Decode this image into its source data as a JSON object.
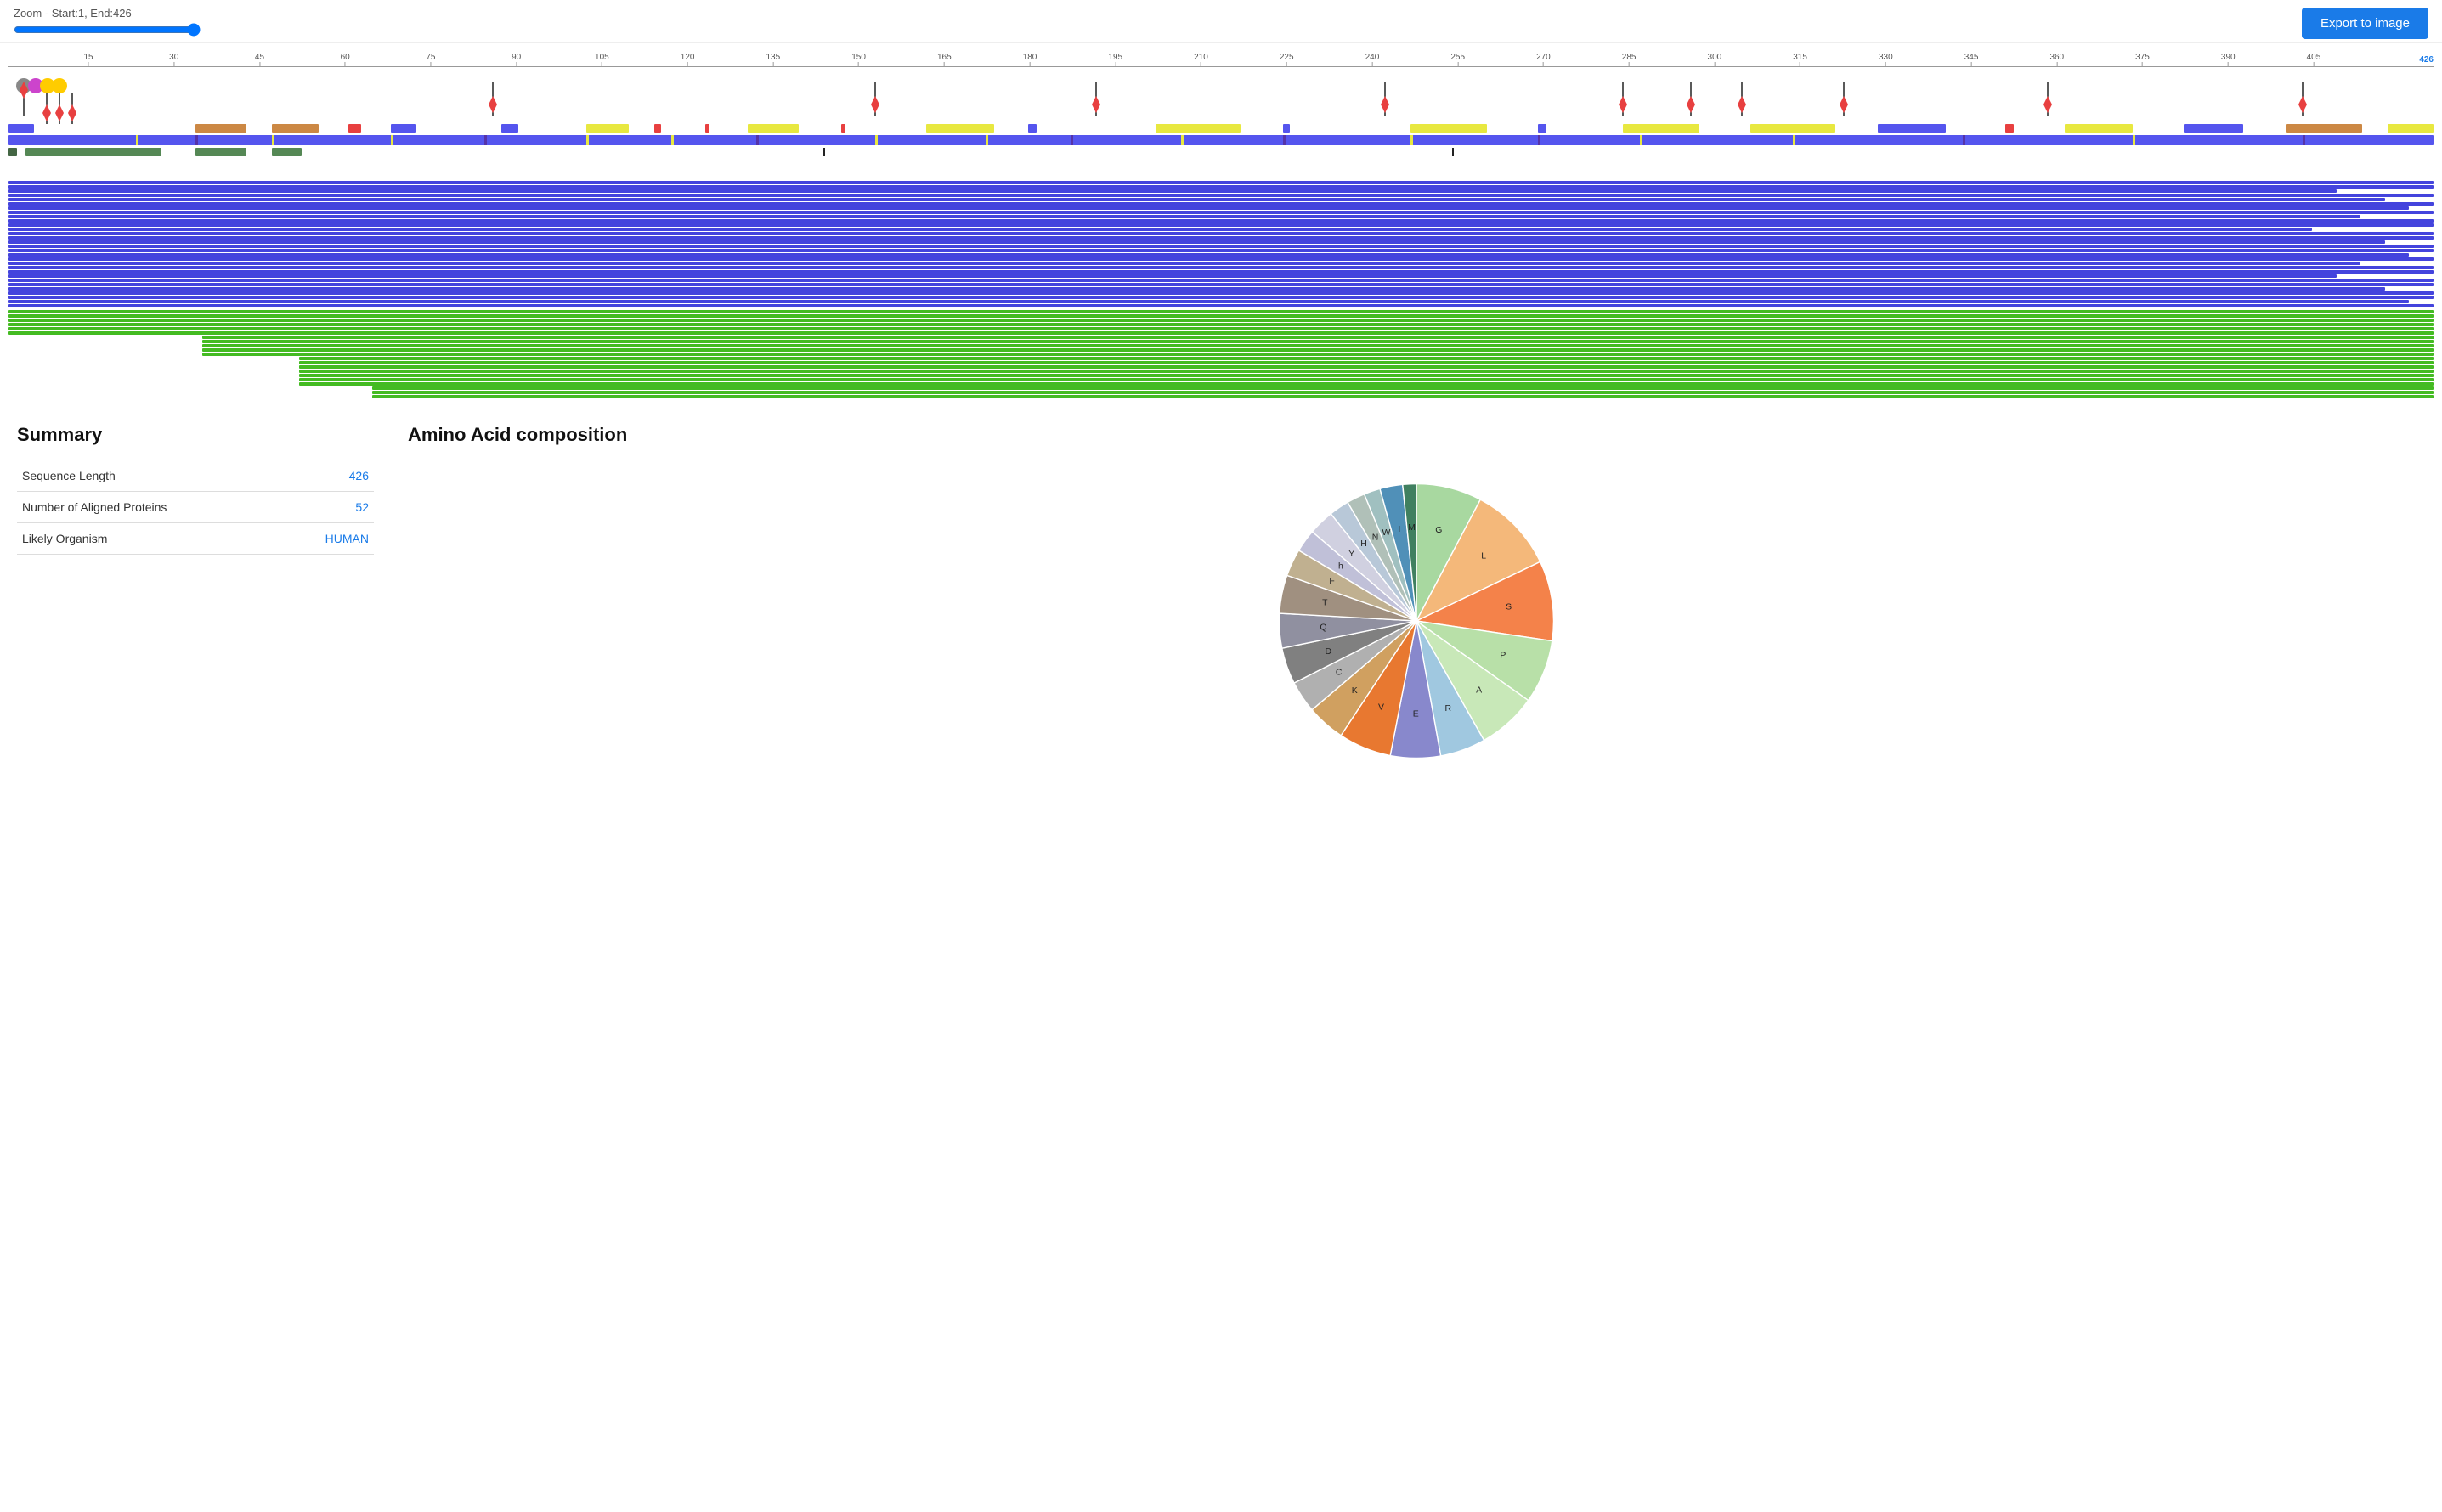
{
  "topbar": {
    "zoom_label": "Zoom - Start:1, End:426",
    "export_button": "Export to image"
  },
  "ruler": {
    "start": 1,
    "end": 426,
    "ticks": [
      15,
      30,
      45,
      60,
      75,
      90,
      105,
      120,
      135,
      150,
      165,
      180,
      195,
      210,
      225,
      240,
      255,
      270,
      285,
      300,
      315,
      330,
      345,
      360,
      375,
      390,
      405
    ]
  },
  "summary": {
    "title": "Summary",
    "rows": [
      {
        "label": "Sequence Length",
        "value": "426"
      },
      {
        "label": "Number of Aligned Proteins",
        "value": "52"
      },
      {
        "label": "Likely Organism",
        "value": "HUMAN"
      }
    ]
  },
  "amino_acid": {
    "title": "Amino Acid composition",
    "segments": [
      {
        "label": "G",
        "value": 7.2,
        "color": "#a8d8a0"
      },
      {
        "label": "L",
        "value": 9.5,
        "color": "#f4b87a"
      },
      {
        "label": "S",
        "value": 8.8,
        "color": "#f4824a"
      },
      {
        "label": "P",
        "value": 7.0,
        "color": "#b8e0a8"
      },
      {
        "label": "A",
        "value": 6.5,
        "color": "#c8e8b8"
      },
      {
        "label": "R",
        "value": 5.0,
        "color": "#a0c8e0"
      },
      {
        "label": "E",
        "value": 5.5,
        "color": "#8888cc"
      },
      {
        "label": "V",
        "value": 5.8,
        "color": "#e87830"
      },
      {
        "label": "K",
        "value": 4.2,
        "color": "#d0a060"
      },
      {
        "label": "C",
        "value": 3.5,
        "color": "#b0b0b0"
      },
      {
        "label": "D",
        "value": 4.0,
        "color": "#808080"
      },
      {
        "label": "Q",
        "value": 3.8,
        "color": "#9090a0"
      },
      {
        "label": "T",
        "value": 4.2,
        "color": "#a09080"
      },
      {
        "label": "F",
        "value": 3.0,
        "color": "#c0b090"
      },
      {
        "label": "h",
        "value": 2.5,
        "color": "#c0c0d8"
      },
      {
        "label": "Y",
        "value": 2.8,
        "color": "#d0d0e0"
      },
      {
        "label": "H",
        "value": 2.2,
        "color": "#b8c8d8"
      },
      {
        "label": "N",
        "value": 2.0,
        "color": "#b0c0b8"
      },
      {
        "label": "W",
        "value": 1.8,
        "color": "#a0c0c0"
      },
      {
        "label": "I",
        "value": 2.5,
        "color": "#5090b8"
      },
      {
        "label": "M",
        "value": 1.5,
        "color": "#408060"
      }
    ]
  }
}
